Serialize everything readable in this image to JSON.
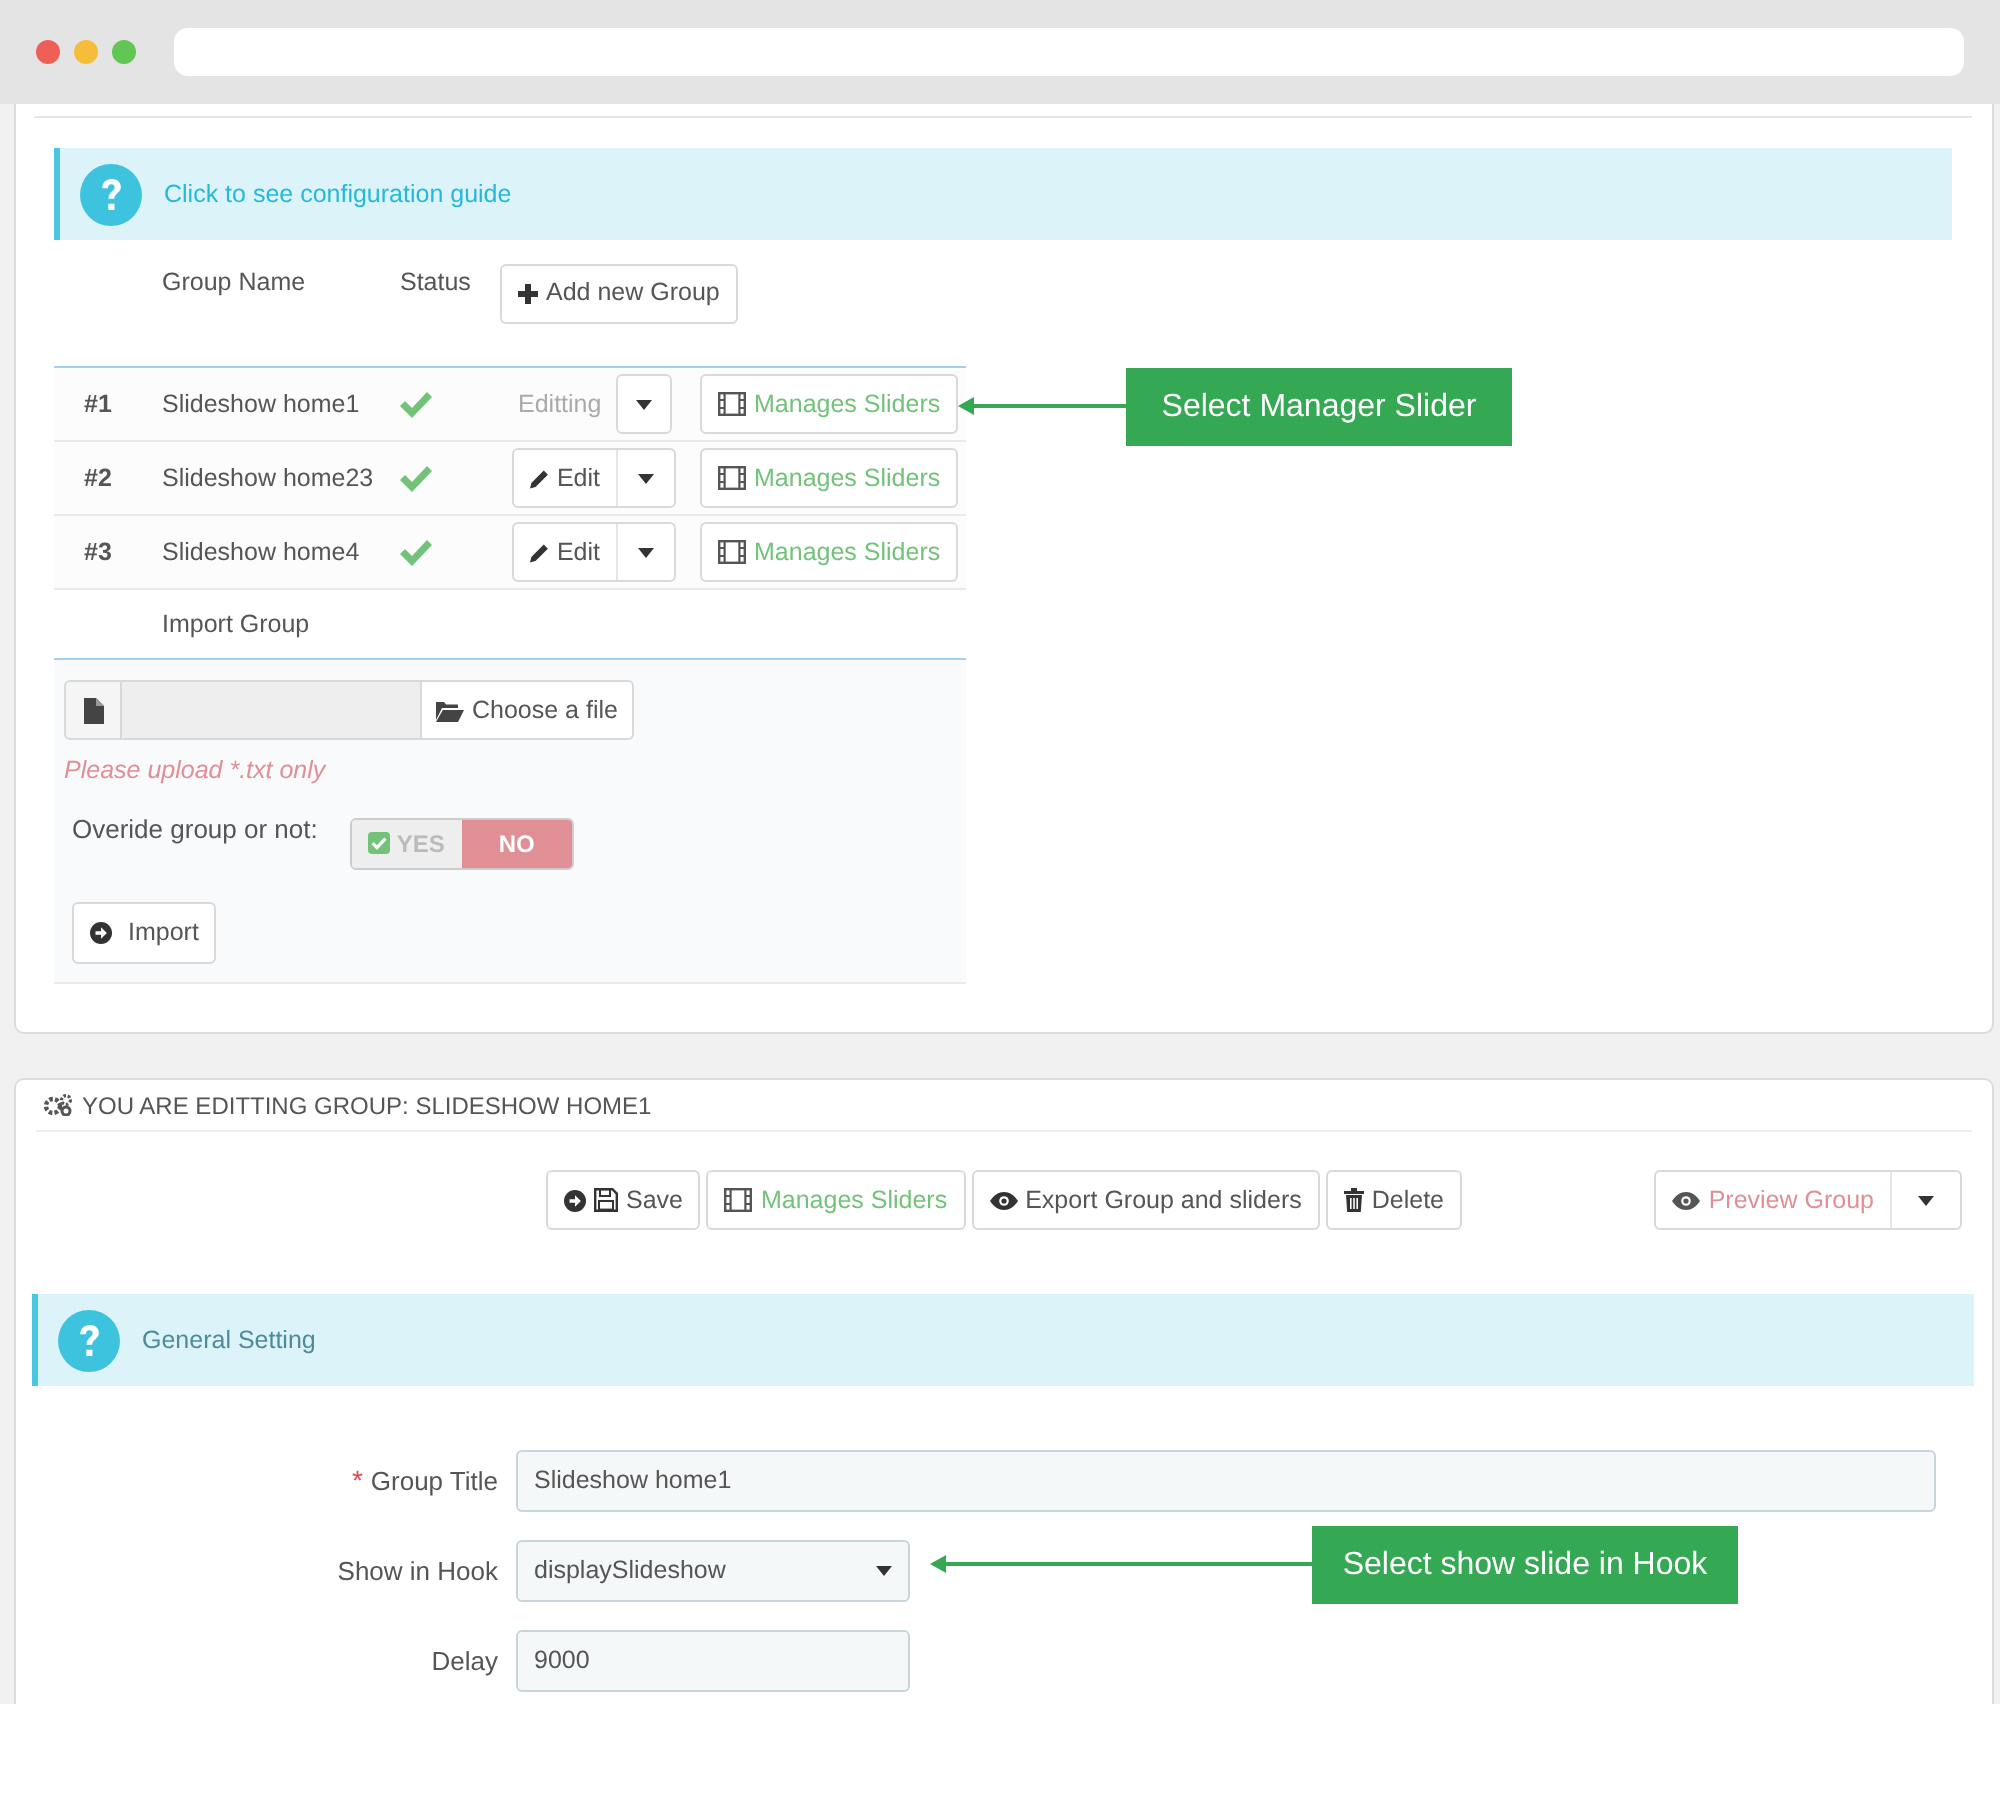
{
  "guide_alert": {
    "text": "Click to see configuration guide"
  },
  "groups_table": {
    "columns": [
      "Group Name",
      "Status"
    ],
    "add_button": "Add new Group",
    "rows": [
      {
        "index": "#1",
        "name": "Slideshow home1",
        "active": true,
        "editing": true,
        "edit_label": "Editting",
        "manage_label": "Manages Sliders"
      },
      {
        "index": "#2",
        "name": "Slideshow home23",
        "active": true,
        "editing": false,
        "edit_label": "Edit",
        "manage_label": "Manages Sliders"
      },
      {
        "index": "#3",
        "name": "Slideshow home4",
        "active": true,
        "editing": false,
        "edit_label": "Edit",
        "manage_label": "Manages Sliders"
      }
    ]
  },
  "import": {
    "heading": "Import Group",
    "choose_button": "Choose a file",
    "hint": "Please upload *.txt only",
    "override_label": "Overide group or not:",
    "override_yes": "YES",
    "override_no": "NO",
    "override_on": false,
    "import_button": "Import"
  },
  "editor": {
    "title": "YOU ARE EDITTING GROUP: SLIDESHOW HOME1",
    "toolbar": [
      {
        "kind": "save",
        "label": "Save"
      },
      {
        "kind": "manage",
        "label": "Manages Sliders"
      },
      {
        "kind": "export",
        "label": "Export Group and sliders"
      },
      {
        "kind": "delete",
        "label": "Delete"
      }
    ],
    "preview_button": "Preview Group",
    "section": "General Setting",
    "fields": [
      {
        "kind": "text",
        "required_mark": "*",
        "label": "Group Title",
        "value": "Slideshow home1"
      },
      {
        "kind": "select",
        "label": "Show in Hook",
        "value": "displaySlideshow"
      },
      {
        "kind": "short",
        "label": "Delay",
        "value": "9000"
      }
    ]
  },
  "annotations": [
    {
      "text": "Select Manager Slider"
    },
    {
      "text": "Select show slide in Hook"
    }
  ]
}
